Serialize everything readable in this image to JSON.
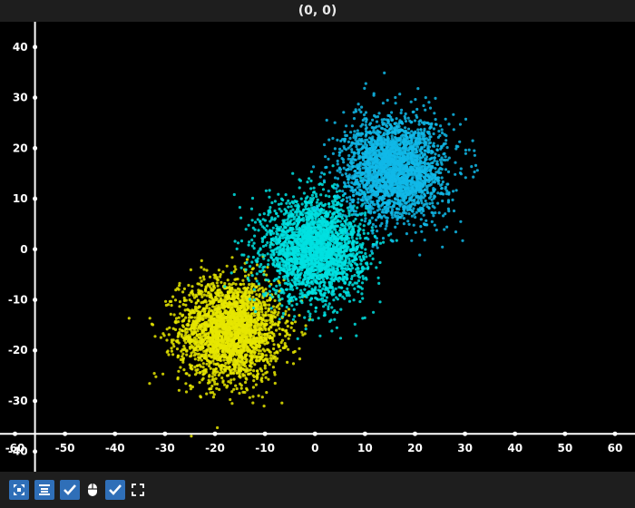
{
  "window": {
    "title": "(0, 0)"
  },
  "toolbar": {
    "buttons": [
      {
        "icon": "fit-axes-icon"
      },
      {
        "icon": "align-icon"
      },
      {
        "icon": "checkbox-checked-icon"
      },
      {
        "icon": "mouse-icon"
      },
      {
        "icon": "checkbox-checked-icon"
      },
      {
        "icon": "fullscreen-icon"
      }
    ]
  },
  "chart_data": {
    "type": "scatter",
    "title": "",
    "xlabel": "",
    "ylabel": "",
    "xlim": [
      -63,
      64
    ],
    "ylim": [
      -44,
      45
    ],
    "x_ticks": [
      -60,
      -50,
      -40,
      -30,
      -20,
      -10,
      0,
      10,
      20,
      30,
      40,
      50,
      60
    ],
    "y_ticks": [
      40,
      30,
      20,
      10,
      0,
      -10,
      -20,
      -30,
      -40
    ],
    "grid": false,
    "series": [
      {
        "color": "#e6e600",
        "center": [
          -17,
          -16
        ],
        "spread": [
          5.0,
          5.0
        ],
        "count": 2600
      },
      {
        "color": "#00e0e0",
        "center": [
          0,
          0
        ],
        "spread": [
          5.0,
          5.0
        ],
        "count": 2600
      },
      {
        "color": "#10b8e8",
        "center": [
          16,
          16
        ],
        "spread": [
          5.0,
          5.0
        ],
        "count": 2600
      }
    ]
  }
}
